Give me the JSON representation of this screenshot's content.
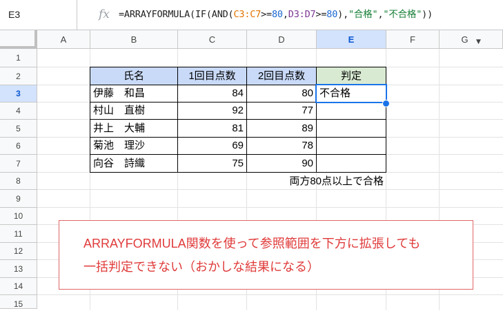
{
  "formula_bar": {
    "name_box": "E3",
    "fx": "fx",
    "formula_parts": [
      {
        "text": "=ARRAYFORMULA(IF(AND(",
        "color": "default"
      },
      {
        "text": "C3:C7",
        "color": "orange"
      },
      {
        "text": ">=",
        "color": "default"
      },
      {
        "text": "80",
        "color": "blue"
      },
      {
        "text": ",",
        "color": "default"
      },
      {
        "text": "D3:D7",
        "color": "purple"
      },
      {
        "text": ">=",
        "color": "default"
      },
      {
        "text": "80",
        "color": "blue"
      },
      {
        "text": "),",
        "color": "default"
      },
      {
        "text": "\"合格\"",
        "color": "green"
      },
      {
        "text": ",",
        "color": "default"
      },
      {
        "text": "\"不合格\"",
        "color": "green"
      },
      {
        "text": "))",
        "color": "default"
      }
    ]
  },
  "columns": [
    "A",
    "B",
    "C",
    "D",
    "E",
    "F",
    "G"
  ],
  "rows": [
    "1",
    "2",
    "3",
    "4",
    "5",
    "6",
    "7",
    "8",
    "9",
    "10",
    "11",
    "12",
    "13",
    "14",
    "15"
  ],
  "selected_column": "E",
  "selected_row": "3",
  "table": {
    "headers": [
      "氏名",
      "1回目点数",
      "2回目点数",
      "判定"
    ],
    "rows": [
      {
        "name": "伊藤　和昌",
        "score1": "84",
        "score2": "80",
        "result": "不合格"
      },
      {
        "name": "村山　直樹",
        "score1": "92",
        "score2": "77",
        "result": ""
      },
      {
        "name": "井上　大輔",
        "score1": "81",
        "score2": "89",
        "result": ""
      },
      {
        "name": "菊池　理沙",
        "score1": "69",
        "score2": "78",
        "result": ""
      },
      {
        "name": "向谷　詩織",
        "score1": "75",
        "score2": "90",
        "result": ""
      }
    ],
    "footnote": "両方80点以上で合格"
  },
  "note": {
    "line1": "ARRAYFORMULA関数を使って参照範囲を下方に拡張しても",
    "line2": "一括判定できない（おかしな結果になる）"
  },
  "colors": {
    "header_blue": "#c9daf8",
    "header_green": "#d9ead3",
    "selection": "#1a73e8",
    "note_text": "#e03a3a"
  }
}
